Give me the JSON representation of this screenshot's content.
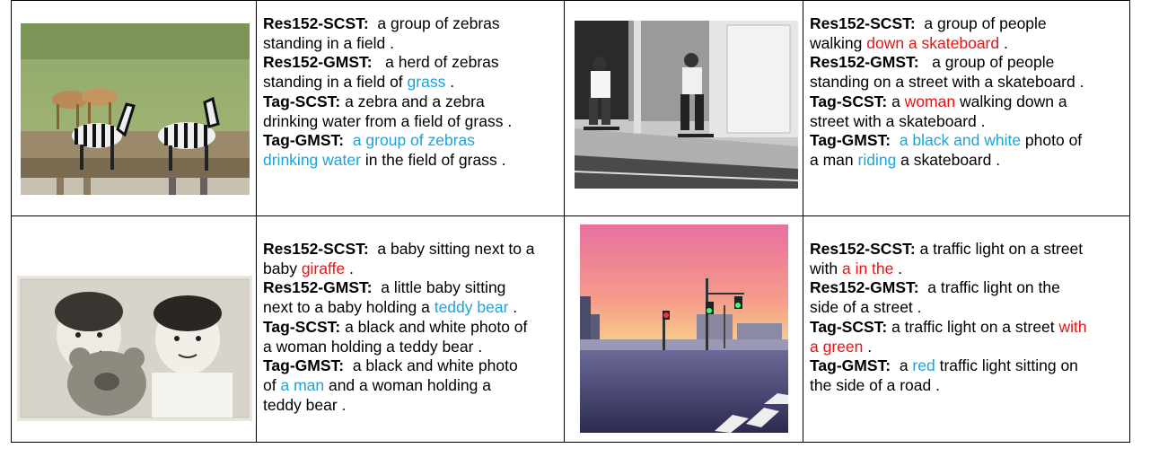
{
  "colors": {
    "good": "#1aa3dd",
    "bad": "#ee1111",
    "text": "#000000",
    "rule": "#000000"
  },
  "cells": [
    {
      "image": "zebras-image",
      "captions": [
        [
          {
            "t": "Res152-SCST:",
            "s": "b"
          },
          {
            "t": "  a group of zebras",
            "s": ""
          }
        ],
        [
          {
            "t": "standing in a field .",
            "s": ""
          }
        ],
        [
          {
            "t": "Res152-GMST:",
            "s": "b"
          },
          {
            "t": "   a herd of zebras",
            "s": ""
          }
        ],
        [
          {
            "t": "standing in a field of ",
            "s": ""
          },
          {
            "t": "grass",
            "s": "blue"
          },
          {
            "t": " .",
            "s": ""
          }
        ],
        [
          {
            "t": "Tag-SCST:",
            "s": "b"
          },
          {
            "t": " a zebra and a zebra",
            "s": ""
          }
        ],
        [
          {
            "t": "drinking water from a field of grass .",
            "s": ""
          }
        ],
        [
          {
            "t": "Tag-GMST:",
            "s": "b"
          },
          {
            "t": "  ",
            "s": ""
          },
          {
            "t": "a group of zebras",
            "s": "blue"
          }
        ],
        [
          {
            "t": "drinking water",
            "s": "blue"
          },
          {
            "t": " in the field of grass .",
            "s": ""
          }
        ]
      ]
    },
    {
      "image": "skateboard-image",
      "captions": [
        [
          {
            "t": "Res152-SCST:",
            "s": "b"
          },
          {
            "t": "  a group of people",
            "s": ""
          }
        ],
        [
          {
            "t": "walking ",
            "s": ""
          },
          {
            "t": "down a skateboard",
            "s": "red"
          },
          {
            "t": " .",
            "s": ""
          }
        ],
        [
          {
            "t": "Res152-GMST:",
            "s": "b"
          },
          {
            "t": "   a group of people",
            "s": ""
          }
        ],
        [
          {
            "t": "standing on a street with a skateboard .",
            "s": ""
          }
        ],
        [
          {
            "t": "Tag-SCST:",
            "s": "b"
          },
          {
            "t": " a ",
            "s": ""
          },
          {
            "t": "woman",
            "s": "red"
          },
          {
            "t": " walking down a",
            "s": ""
          }
        ],
        [
          {
            "t": "street with a skateboard .",
            "s": ""
          }
        ],
        [
          {
            "t": "Tag-GMST:",
            "s": "b"
          },
          {
            "t": "  ",
            "s": ""
          },
          {
            "t": "a black and white",
            "s": "blue"
          },
          {
            "t": " photo of",
            "s": ""
          }
        ],
        [
          {
            "t": "a man ",
            "s": ""
          },
          {
            "t": "riding",
            "s": "blue"
          },
          {
            "t": " a skateboard .",
            "s": ""
          }
        ]
      ]
    },
    {
      "image": "baby-photo-image",
      "captions": [
        [
          {
            "t": "Res152-SCST:",
            "s": "b"
          },
          {
            "t": "  a baby sitting next to a",
            "s": ""
          }
        ],
        [
          {
            "t": "baby ",
            "s": ""
          },
          {
            "t": "giraffe",
            "s": "red"
          },
          {
            "t": " .",
            "s": ""
          }
        ],
        [
          {
            "t": "Res152-GMST:",
            "s": "b"
          },
          {
            "t": "  a little baby sitting",
            "s": ""
          }
        ],
        [
          {
            "t": "next to a baby holding a ",
            "s": ""
          },
          {
            "t": "teddy bear",
            "s": "blue"
          },
          {
            "t": " .",
            "s": ""
          }
        ],
        [
          {
            "t": "Tag-SCST:",
            "s": "b"
          },
          {
            "t": " a black and white photo of",
            "s": ""
          }
        ],
        [
          {
            "t": "a woman holding a teddy bear .",
            "s": ""
          }
        ],
        [
          {
            "t": "Tag-GMST:",
            "s": "b"
          },
          {
            "t": "  a black and white photo",
            "s": ""
          }
        ],
        [
          {
            "t": "of ",
            "s": ""
          },
          {
            "t": "a man",
            "s": "blue"
          },
          {
            "t": " and a woman holding a",
            "s": ""
          }
        ],
        [
          {
            "t": "teddy bear .",
            "s": ""
          }
        ]
      ]
    },
    {
      "image": "traffic-light-image",
      "captions": [
        [
          {
            "t": "Res152-SCST:",
            "s": "b"
          },
          {
            "t": " a traffic light on a street",
            "s": ""
          }
        ],
        [
          {
            "t": "with ",
            "s": ""
          },
          {
            "t": "a in the",
            "s": "red"
          },
          {
            "t": " .",
            "s": ""
          }
        ],
        [
          {
            "t": "Res152-GMST:",
            "s": "b"
          },
          {
            "t": "  a traffic light on the",
            "s": ""
          }
        ],
        [
          {
            "t": "side of a street .",
            "s": ""
          }
        ],
        [
          {
            "t": "Tag-SCST:",
            "s": "b"
          },
          {
            "t": " a traffic light on a street ",
            "s": ""
          },
          {
            "t": "with",
            "s": "red"
          }
        ],
        [
          {
            "t": "a green",
            "s": "red"
          },
          {
            "t": " .",
            "s": ""
          }
        ],
        [
          {
            "t": "Tag-GMST:",
            "s": "b"
          },
          {
            "t": "  a ",
            "s": ""
          },
          {
            "t": "red",
            "s": "blue"
          },
          {
            "t": " traffic light sitting on",
            "s": ""
          }
        ],
        [
          {
            "t": "the side of a road .",
            "s": ""
          }
        ]
      ]
    }
  ]
}
